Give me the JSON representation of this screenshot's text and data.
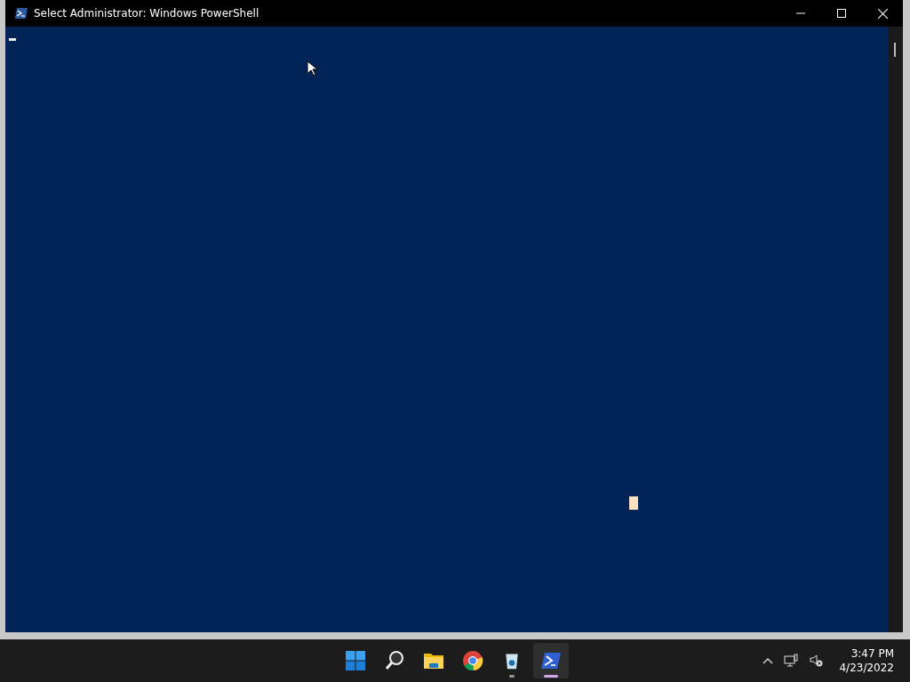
{
  "window": {
    "title": "Select Administrator: Windows PowerShell"
  },
  "taskbar": {
    "apps": [
      {
        "kind": "start",
        "selected": false,
        "running": false
      },
      {
        "kind": "search",
        "selected": false,
        "running": false
      },
      {
        "kind": "folder",
        "selected": false,
        "running": false
      },
      {
        "kind": "browser",
        "selected": false,
        "running": false
      },
      {
        "kind": "bin",
        "selected": false,
        "running": true
      },
      {
        "kind": "shell",
        "selected": true,
        "running": true
      }
    ]
  },
  "tray": {
    "time": "3:47 PM",
    "date": "4/23/2022"
  }
}
